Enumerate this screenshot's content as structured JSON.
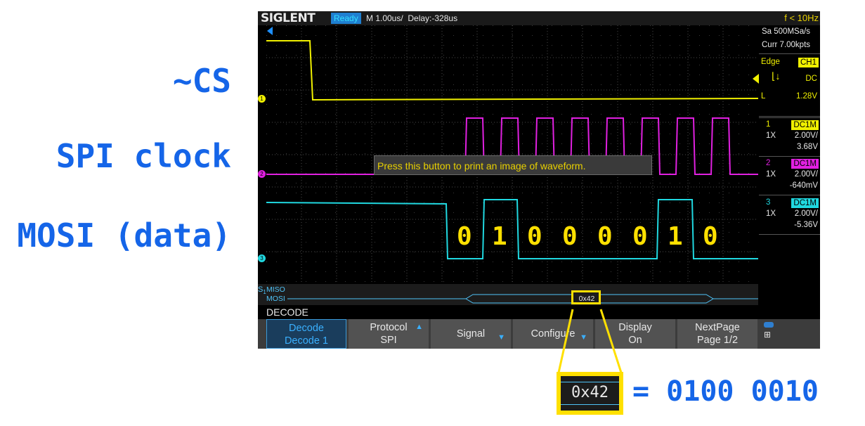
{
  "annotations": {
    "cs": "~CS",
    "clock": "SPI clock",
    "mosi": "MOSI (data)",
    "equation": "= 0100 0010",
    "zoom_value": "0x42"
  },
  "scope": {
    "brand": "SIGLENT",
    "status": "Ready",
    "timebase": "M 1.00us/",
    "delay": "Delay:-328us",
    "trigger_freq": "f < 10Hz",
    "sample_rate": "Sa 500MSa/s",
    "memory": "Curr 7.00kpts",
    "trigger": {
      "type": "Edge",
      "source": "CH1",
      "coupling": "DC",
      "level_label": "L",
      "level": "1.28V"
    },
    "channels": [
      {
        "num": "1",
        "coupling": "DC1M",
        "probe": "1X",
        "scale": "2.00V/",
        "offset": "3.68V",
        "color": "#f0f000"
      },
      {
        "num": "2",
        "coupling": "DC1M",
        "probe": "1X",
        "scale": "2.00V/",
        "offset": "-640mV",
        "color": "#e020e0"
      },
      {
        "num": "3",
        "coupling": "DC1M",
        "probe": "1X",
        "scale": "2.00V/",
        "offset": "-5.36V",
        "color": "#20d8e0"
      }
    ],
    "tooltip": "Press this button to print an image of waveform.",
    "bits": [
      "0",
      "1",
      "0",
      "0",
      "0",
      "0",
      "1",
      "0"
    ],
    "bus": {
      "lane1": "MISO",
      "lane2": "MOSI",
      "s_marker": "S",
      "s_sub": "1",
      "value": "0x42"
    },
    "decode_label": "DECODE",
    "menu": [
      {
        "line1": "Decode",
        "line2": "Decode 1"
      },
      {
        "line1": "Protocol",
        "line2": "SPI"
      },
      {
        "line1": "Signal",
        "line2": ""
      },
      {
        "line1": "Configure",
        "line2": ""
      },
      {
        "line1": "Display",
        "line2": "On"
      },
      {
        "line1": "NextPage",
        "line2": "Page 1/2"
      }
    ],
    "ch_markers": [
      "1",
      "2",
      "3"
    ]
  }
}
